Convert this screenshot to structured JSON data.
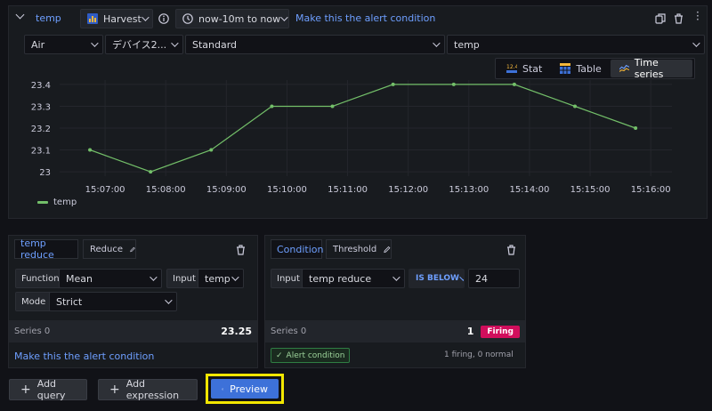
{
  "query": {
    "collapse_icon": "chevron-down-icon",
    "name": "temp",
    "datasource": "Harvest",
    "time_range": "now-10m to now",
    "alert_link": "Make this the alert condition",
    "filters": [
      "Air",
      "デバイス2...",
      "Standard",
      "temp"
    ]
  },
  "view_tabs": [
    {
      "label": "Stat",
      "icon": "stat-icon"
    },
    {
      "label": "Table",
      "icon": "table-icon"
    },
    {
      "label": "Time series",
      "icon": "timeseries-icon",
      "active": true
    }
  ],
  "chart_data": {
    "type": "line",
    "x": [
      "15:06:45",
      "15:07:45",
      "15:08:45",
      "15:09:45",
      "15:10:45",
      "15:11:45",
      "15:12:45",
      "15:13:45",
      "15:14:45",
      "15:15:45"
    ],
    "series": [
      {
        "name": "temp",
        "values": [
          23.1,
          23.0,
          23.1,
          23.3,
          23.3,
          23.4,
          23.4,
          23.4,
          23.3,
          23.2
        ],
        "color": "#73bf69"
      }
    ],
    "y_ticks": [
      "23",
      "23.1",
      "23.2",
      "23.3",
      "23.4"
    ],
    "x_ticks": [
      "15:07:00",
      "15:08:00",
      "15:09:00",
      "15:10:00",
      "15:11:00",
      "15:12:00",
      "15:13:00",
      "15:14:00",
      "15:15:00",
      "15:16:00"
    ],
    "ylim": [
      22.98,
      23.42
    ],
    "grid": true,
    "legend": "bottom-left"
  },
  "reduce_card": {
    "title": "temp reduce",
    "type": "Reduce",
    "function_label": "Function",
    "function_value": "Mean",
    "input_label": "Input",
    "input_value": "temp",
    "mode_label": "Mode",
    "mode_value": "Strict",
    "series_label": "Series 0",
    "series_value": "23.25",
    "alert_link": "Make this the alert condition"
  },
  "condition_card": {
    "title": "Condition",
    "type": "Threshold",
    "input_label": "Input",
    "input_value": "temp reduce",
    "operator": "IS BELOW",
    "threshold": "24",
    "series_label": "Series 0",
    "series_value": "1",
    "status": "Firing",
    "alert_condition_badge": "Alert condition",
    "summary": "1 firing, 0 normal"
  },
  "footer": {
    "add_query": "Add query",
    "add_expression": "Add expression",
    "preview": "Preview"
  },
  "colors": {
    "accent": "#6e9fff",
    "preview_bg": "#3d71d9",
    "highlight": "#f2e600",
    "firing": "#d10e5c",
    "series": "#73bf69"
  }
}
